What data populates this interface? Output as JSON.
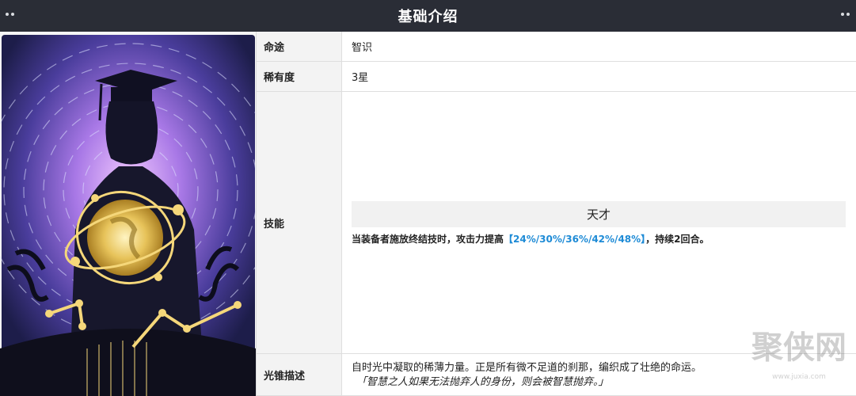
{
  "header": {
    "title": "基础介绍"
  },
  "rows": {
    "path": {
      "label": "命途",
      "value": "智识"
    },
    "rarity": {
      "label": "稀有度",
      "value": "3星"
    },
    "skill": {
      "label": "技能",
      "name": "天才",
      "desc_before": "当装备者施放终结技时，攻击力提高",
      "desc_highlight": "【24%/30%/36%/42%/48%】",
      "desc_after": "，持续2回合。"
    },
    "lore": {
      "label": "光锥描述",
      "line1": "自时光中凝取的稀薄力量。正是所有微不足道的刹那，编织成了壮绝的命运。",
      "line2": "「智慧之人如果无法抛弃人的身份，则会被智慧抛弃。」"
    }
  },
  "watermark": {
    "text": "聚侠网",
    "url": "www.juxia.com"
  },
  "colors": {
    "header_bg": "#2a2d36",
    "highlight": "#1e8bd6",
    "label_bg": "#f3f3f3"
  }
}
